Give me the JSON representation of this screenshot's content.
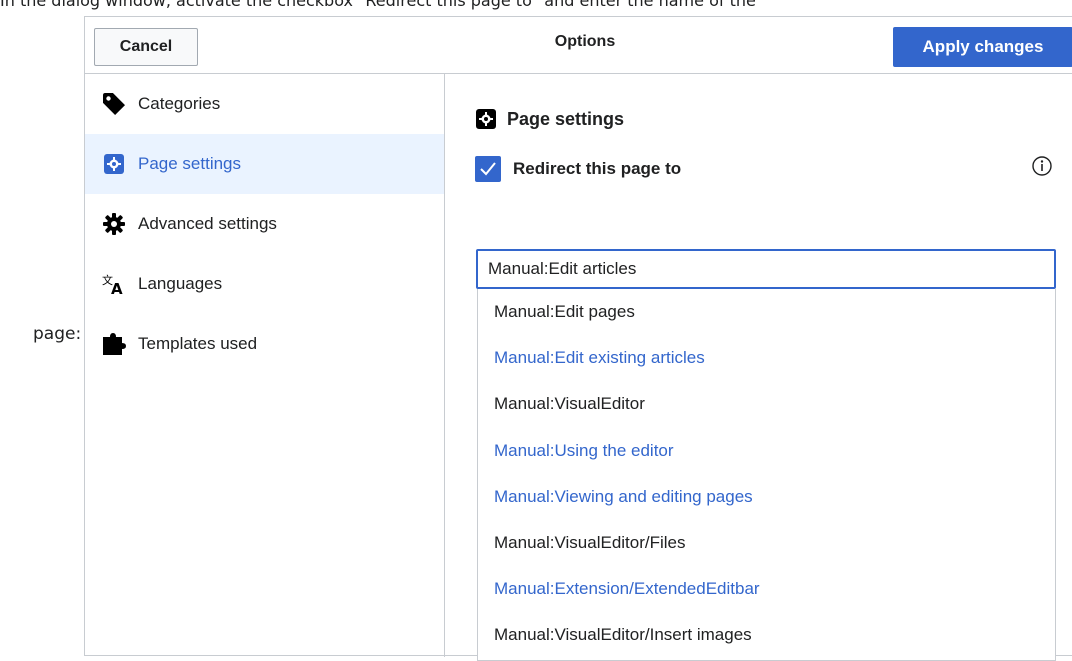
{
  "instruction": "In the dialog window, activate the checkbox \"Redirect this page to\" and enter the name of the",
  "side_label": "page:",
  "header": {
    "cancel_label": "Cancel",
    "title": "Options",
    "apply_label": "Apply changes"
  },
  "sidebar": {
    "items": [
      {
        "label": "Categories",
        "icon": "tag-icon"
      },
      {
        "label": "Page settings",
        "icon": "settings-icon",
        "active": true
      },
      {
        "label": "Advanced settings",
        "icon": "gear-icon"
      },
      {
        "label": "Languages",
        "icon": "language-icon"
      },
      {
        "label": "Templates used",
        "icon": "puzzle-icon"
      }
    ]
  },
  "main": {
    "heading": "Page settings",
    "redirect_label": "Redirect this page to",
    "redirect_checked": true,
    "input_value": "Manual:Edit articles",
    "suggestions": [
      {
        "text": "Manual:Edit pages",
        "style": "dark"
      },
      {
        "text": "Manual:Edit existing articles",
        "style": "link"
      },
      {
        "text": "Manual:VisualEditor",
        "style": "dark"
      },
      {
        "text": "Manual:Using the editor",
        "style": "link"
      },
      {
        "text": "Manual:Viewing and editing pages",
        "style": "link"
      },
      {
        "text": "Manual:VisualEditor/Files",
        "style": "dark"
      },
      {
        "text": "Manual:Extension/ExtendedEditbar",
        "style": "link"
      },
      {
        "text": "Manual:VisualEditor/Insert images",
        "style": "dark"
      }
    ]
  },
  "colors": {
    "accent": "#3366cc",
    "active_bg": "#eaf3ff",
    "border": "#c8ccd1",
    "text": "#202122"
  }
}
